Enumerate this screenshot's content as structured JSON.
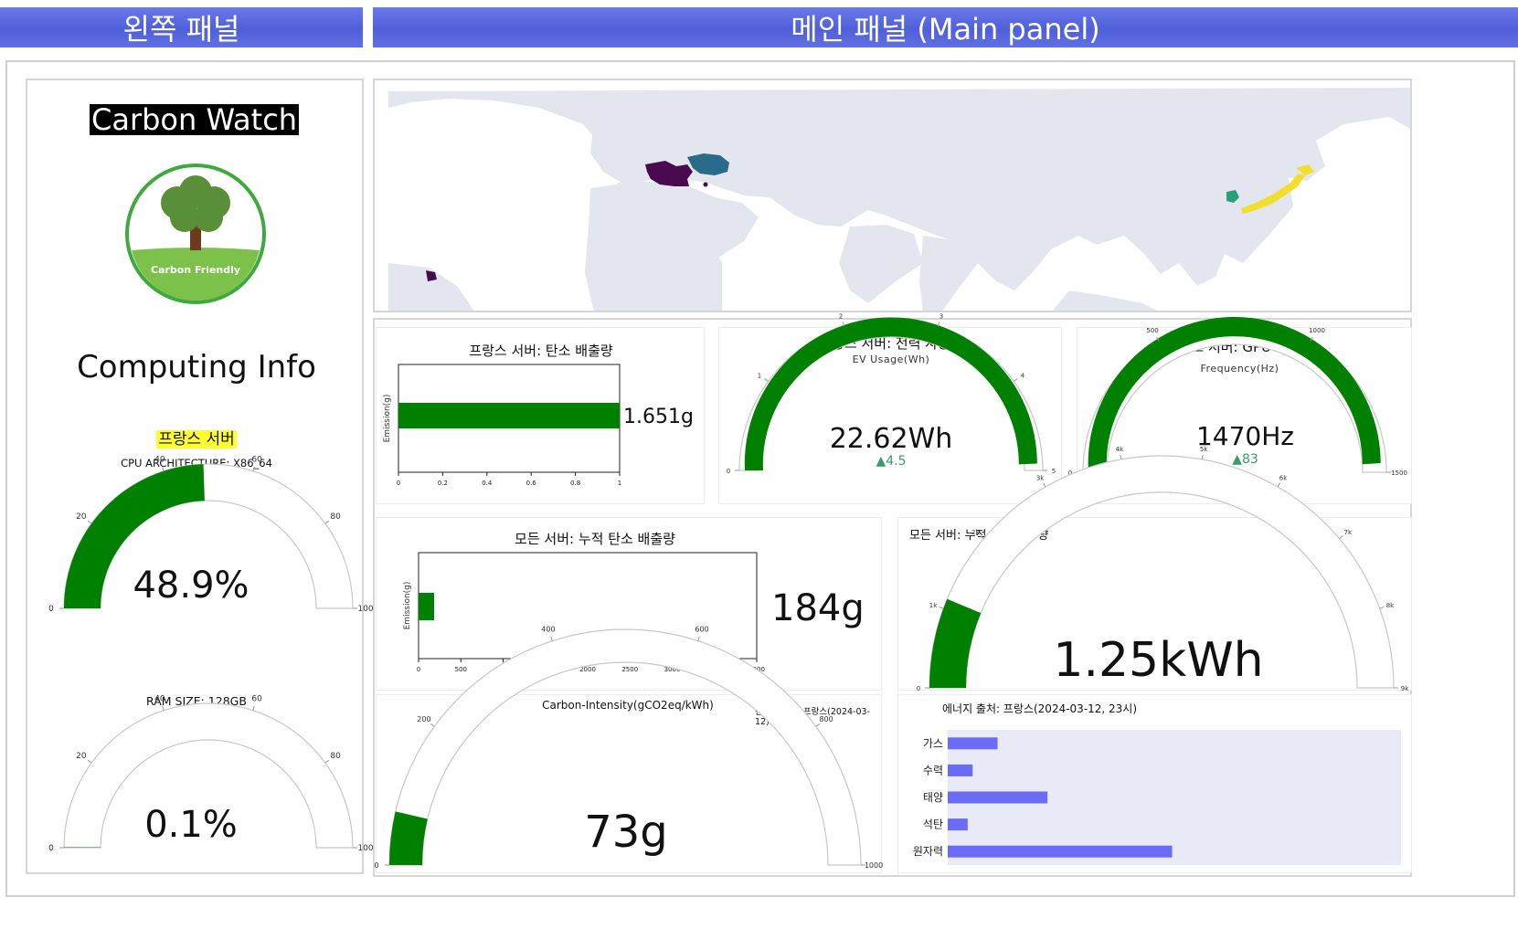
{
  "header": {
    "left_title": "왼쪽 패널",
    "main_title": "메인 패널 (Main panel)"
  },
  "left": {
    "app_title": "Carbon Watch",
    "badge_label": "Carbon Friendly",
    "section_title": "Computing Info",
    "server_label": "프랑스 서버",
    "cpu_arch": "CPU ARCHITECTURE: X86_64",
    "cpu_gauge": {
      "value_text": "48.9%",
      "value": 48.9,
      "max": 100,
      "ticks": [
        "0",
        "20",
        "40",
        "60",
        "80",
        "100"
      ]
    },
    "ram_size": "RAM SIZE: 128GB",
    "ram_gauge": {
      "value_text": "0.1%",
      "value": 0.1,
      "max": 100,
      "ticks": [
        "0",
        "20",
        "40",
        "60",
        "80",
        "100"
      ]
    }
  },
  "map": {
    "highlighted_countries": [
      "France",
      "Germany",
      "Japan",
      "South Korea",
      "French Guiana"
    ]
  },
  "cards": {
    "france_emission": {
      "title": "프랑스 서버:  탄소 배출량",
      "ylabel": "Emission(g)",
      "value_text": "1.651g",
      "value": 1.651,
      "xlim": [
        0,
        1
      ],
      "ticks": [
        "0",
        "0.2",
        "0.4",
        "0.6",
        "0.8",
        "1"
      ]
    },
    "france_power": {
      "title": "프랑스 서버:  전력 사용량",
      "subtitle": "EV Usage(Wh)",
      "value_text": "22.62Wh",
      "delta_text": "▲4.5",
      "value": 22.62,
      "max": 5,
      "ticks": [
        "0",
        "1",
        "2",
        "3",
        "4",
        "5"
      ]
    },
    "france_gpu": {
      "title": "프랑스 서버:  GPU 주파수",
      "subtitle": "Frequency(Hz)",
      "value_text": "1470Hz",
      "delta_text": "▲83",
      "value": 1470,
      "max": 1500,
      "ticks": [
        "0",
        "500",
        "1000",
        "1500"
      ]
    },
    "all_emission": {
      "title": "모든 서버: 누적 탄소 배출량",
      "ylabel": "Emission(g)",
      "value_text": "184g",
      "value": 184,
      "xlim": [
        0,
        4000
      ],
      "ticks": [
        "0",
        "500",
        "1000",
        "1500",
        "2000",
        "2500",
        "3000",
        "3500",
        "4000"
      ]
    },
    "all_power": {
      "title": "모든 서버: 누적 전력 사용량",
      "value_text": "1.25kWh",
      "value": 1.25,
      "max": 10,
      "ticks": [
        "0",
        "1k",
        "2k",
        "3k",
        "4k",
        "5k",
        "6k",
        "7k",
        "8k",
        "9k"
      ]
    },
    "carbon_intensity": {
      "title": "Carbon-Intensity(gCO2eq/kWh)",
      "side_label": "탄소 밀집도: 프랑스(2024-03-12)",
      "value_text": "73g",
      "value": 73,
      "max": 1000,
      "ticks": [
        "0",
        "200",
        "400",
        "600",
        "800",
        "1000"
      ]
    },
    "energy_source": {
      "title": "에너지 출처: 프랑스(2024-03-12, 23시)"
    }
  },
  "chart_data": [
    {
      "type": "bar",
      "title": "에너지 출처: 프랑스(2024-03-12, 23시)",
      "categories": [
        "가스",
        "수력",
        "태양",
        "석탄",
        "원자력"
      ],
      "values": [
        0.2,
        0.1,
        0.4,
        0.08,
        0.9
      ],
      "xlim": [
        0,
        1
      ]
    }
  ],
  "colors": {
    "header": "#5a68e0",
    "gauge_fill": "#008000",
    "bar_fill": "#008000",
    "energy_bar": "#6a6cf6",
    "energy_bg": "#e8ebf7",
    "map_land": "#e3e6ee",
    "delta": "#3a9a6a",
    "badge_green": "#3fa83f"
  }
}
